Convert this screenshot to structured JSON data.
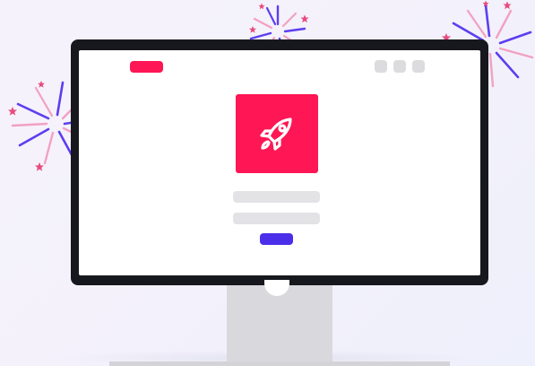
{
  "colors": {
    "brand_pink": "#ff1654",
    "accent_blue": "#4a2eea",
    "monitor_frame": "#17181d",
    "placeholder_gray": "#e3e3e6"
  },
  "icons": {
    "app_icon": "rocket-icon",
    "decoration": "firework-icon"
  },
  "screen": {
    "window_controls": [
      "window-control",
      "window-control",
      "window-control"
    ],
    "text_placeholders": 2,
    "button_label": ""
  }
}
